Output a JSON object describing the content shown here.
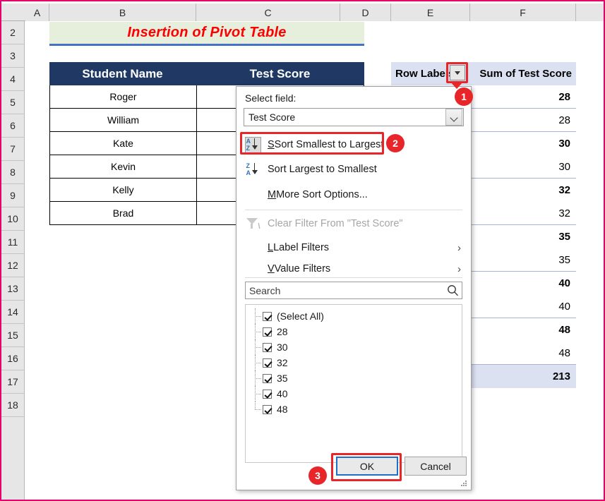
{
  "spreadsheet": {
    "column_headers": [
      "A",
      "B",
      "C",
      "D",
      "E",
      "F"
    ],
    "row_headers": [
      "2",
      "3",
      "4",
      "5",
      "6",
      "7",
      "8",
      "9",
      "10",
      "11",
      "12",
      "13",
      "14",
      "15",
      "16",
      "17",
      "18"
    ],
    "title_banner": "Insertion of Pivot Table",
    "title_color": "#ff0000",
    "banner_bg": "#e6efdc",
    "banner_border": "#4472c4"
  },
  "source_table": {
    "headers": [
      "Student Name",
      "Test Score"
    ],
    "header_bg": "#1f3864",
    "rows": [
      {
        "name": "Roger",
        "score": ""
      },
      {
        "name": "William",
        "score": ""
      },
      {
        "name": "Kate",
        "score": ""
      },
      {
        "name": "Kevin",
        "score": ""
      },
      {
        "name": "Kelly",
        "score": ""
      },
      {
        "name": "Brad",
        "score": ""
      }
    ]
  },
  "pivot_table": {
    "header_row_labels": "Row Labels",
    "header_sum": "Sum of Test Score",
    "header_bg": "#dce1f2",
    "rows": [
      {
        "label": "",
        "value": "28",
        "bold": true
      },
      {
        "label": "",
        "value": "28",
        "bold": false
      },
      {
        "label": "",
        "value": "30",
        "bold": true
      },
      {
        "label": "",
        "value": "30",
        "bold": false
      },
      {
        "label": "",
        "value": "32",
        "bold": true
      },
      {
        "label": "",
        "value": "32",
        "bold": false
      },
      {
        "label": "",
        "value": "35",
        "bold": true
      },
      {
        "label": "",
        "value": "35",
        "bold": false
      },
      {
        "label": "",
        "value": "40",
        "bold": true
      },
      {
        "label": "",
        "value": "40",
        "bold": false
      },
      {
        "label": "",
        "value": "48",
        "bold": true
      },
      {
        "label": "",
        "value": "48",
        "bold": false
      }
    ],
    "grand_total": {
      "label": "",
      "value": "213"
    }
  },
  "filter_panel": {
    "select_field_label": "Select field:",
    "selected_field": "Test Score",
    "sort_asc": "Sort Smallest to Largest",
    "sort_desc": "Sort Largest to Smallest",
    "more_sort": "More Sort Options...",
    "clear_filter": "Clear Filter From \"Test Score\"",
    "label_filters": "Label Filters",
    "value_filters": "Value Filters",
    "submenu_arrow": "›",
    "search_placeholder": "Search",
    "checkbox_items": [
      "(Select All)",
      "28",
      "30",
      "32",
      "35",
      "40",
      "48"
    ],
    "ok_label": "OK",
    "cancel_label": "Cancel"
  },
  "annotations": {
    "badge_1": "1",
    "badge_2": "2",
    "badge_3": "3",
    "color": "#e8262a"
  }
}
